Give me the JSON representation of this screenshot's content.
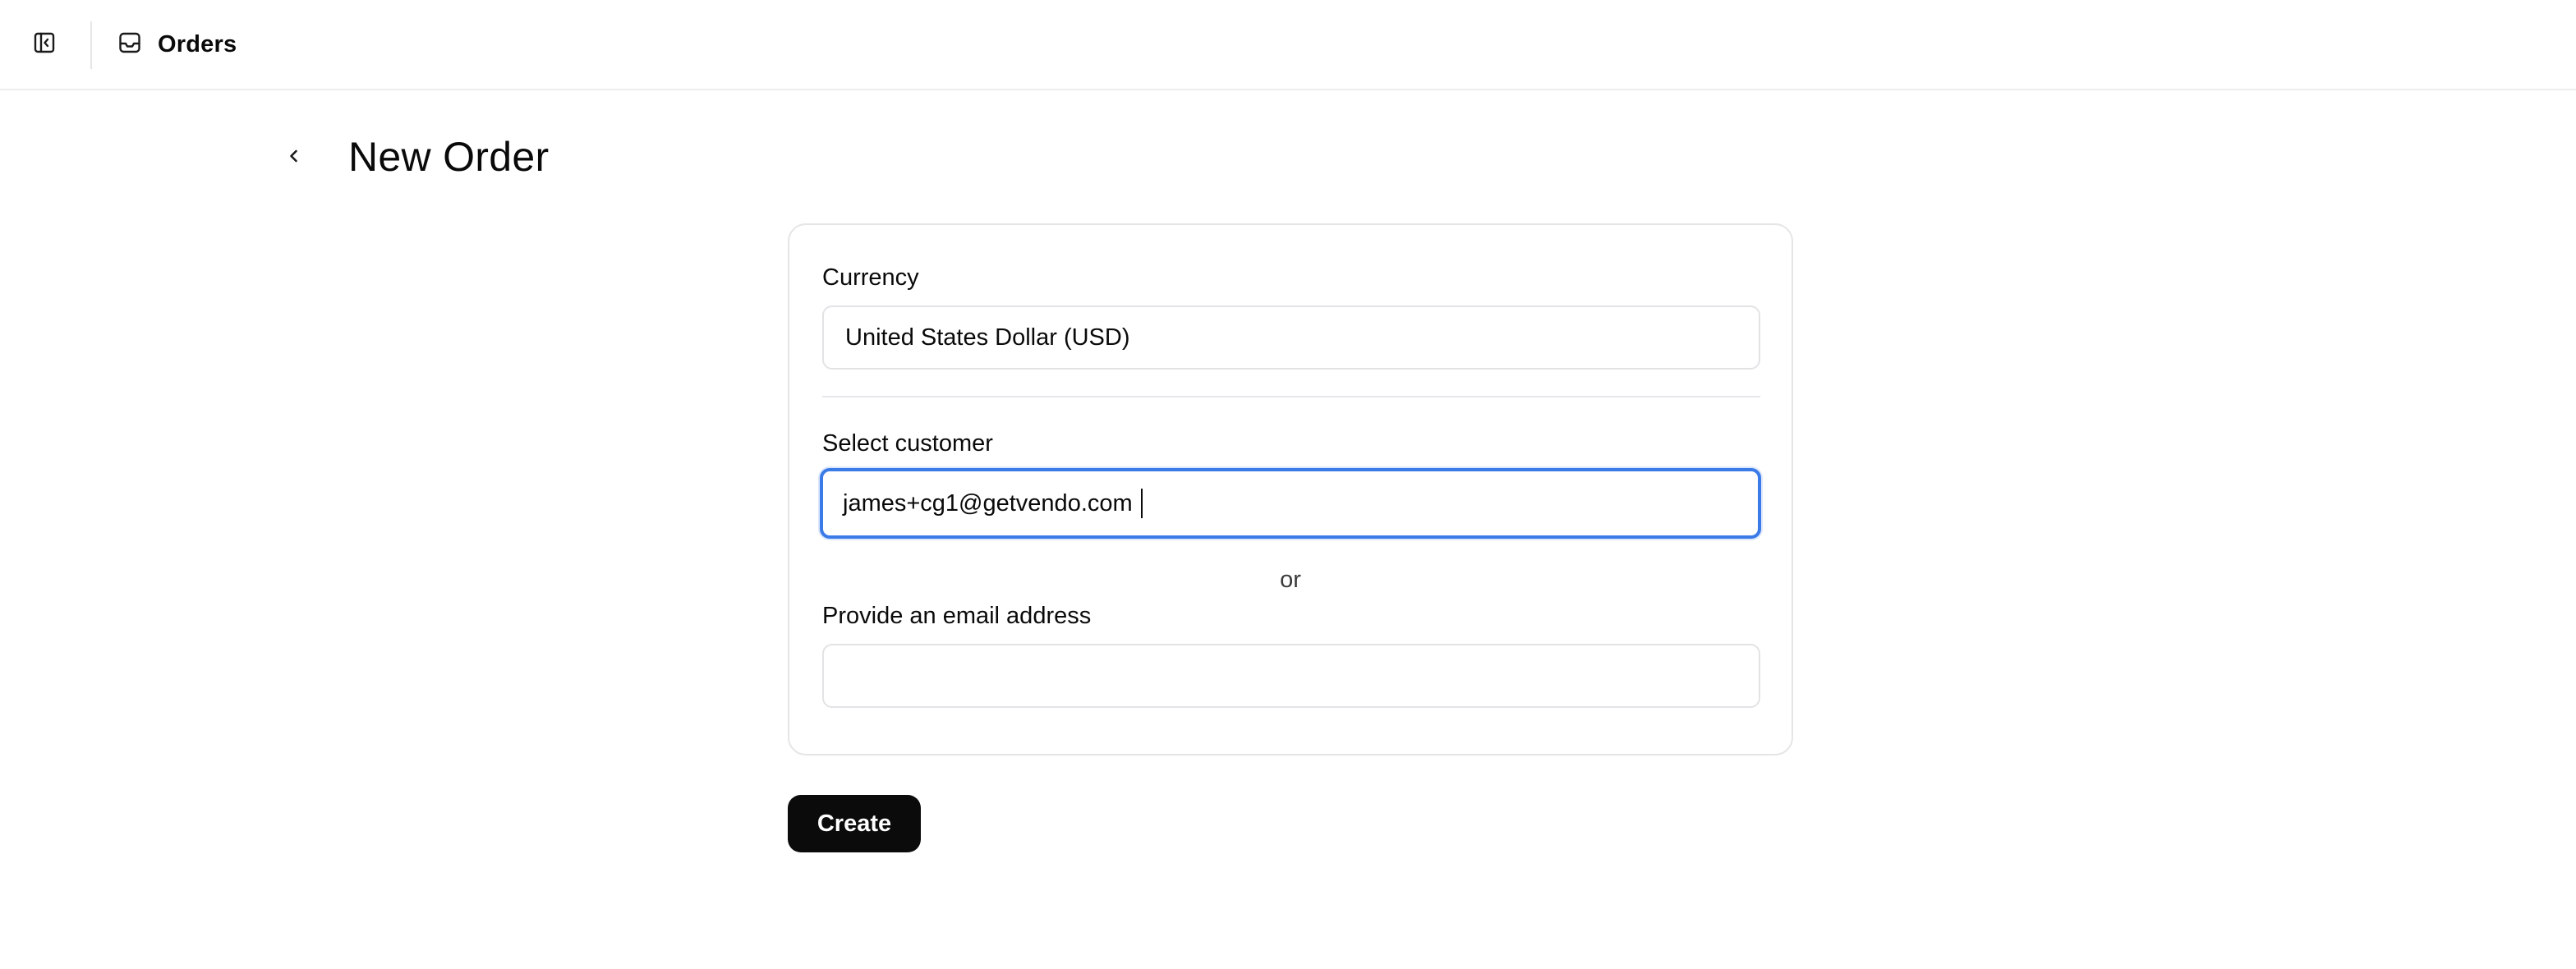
{
  "topbar": {
    "breadcrumb_label": "Orders",
    "sidebar_toggle_icon": "sidebar-toggle-icon",
    "breadcrumb_icon": "inbox-icon"
  },
  "page": {
    "title": "New Order",
    "back_icon": "chevron-left-icon"
  },
  "form": {
    "currency": {
      "label": "Currency",
      "value": "United States Dollar (USD)"
    },
    "customer": {
      "label": "Select customer",
      "value": "james+cg1@getvendo.com"
    },
    "or_text": "or",
    "email": {
      "label": "Provide an email address",
      "value": ""
    },
    "submit_label": "Create"
  },
  "colors": {
    "focus_ring": "#3b7be8",
    "primary_button": "#0b0b0b"
  }
}
